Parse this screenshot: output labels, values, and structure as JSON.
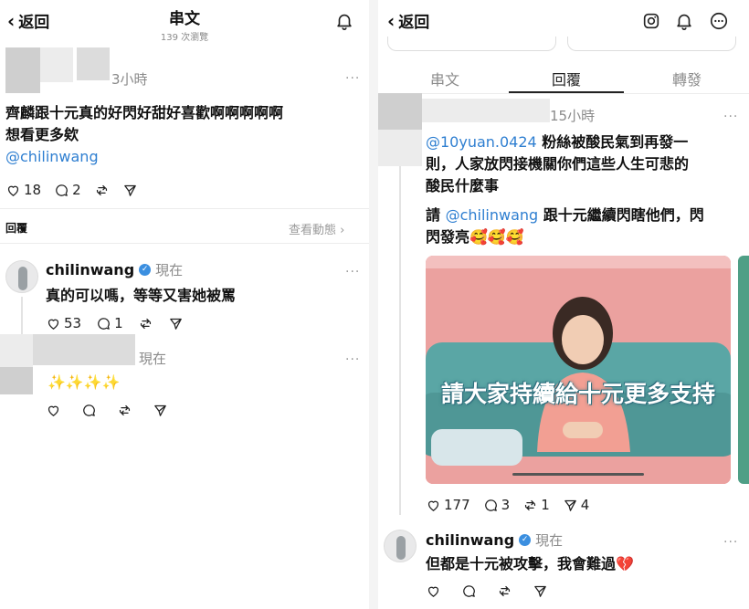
{
  "left": {
    "back_label": "返回",
    "title": "串文",
    "views": "139 次瀏覽",
    "post": {
      "time": "3小時",
      "text_line1": "齊麟跟十元真的好閃好甜好喜歡啊啊啊啊啊",
      "text_line2": "想看更多欸",
      "mention": "@chilinwang",
      "likes": "18",
      "comments": "2"
    },
    "replies_label": "回覆",
    "view_activity": "查看動態 ›",
    "reply1": {
      "username": "chilinwang",
      "time": "現在",
      "text": "真的可以嗎，等等又害她被罵",
      "likes": "53",
      "comments": "1"
    },
    "reply2": {
      "time": "現在",
      "text": "✨✨✨✨"
    }
  },
  "right": {
    "back_label": "返回",
    "tabs": [
      "串文",
      "回覆",
      "轉發"
    ],
    "post": {
      "time": "15小時",
      "mention1": "@10yuan.0424",
      "text1a": " 粉絲被酸民氣到再發一",
      "text1b": "則，人家放閃接機關你們這些人生可悲的",
      "text1c": "酸民什麼事",
      "text2a": "請 ",
      "mention2": "@chilinwang",
      "text2b": " 跟十元繼續閃瞎他們，閃",
      "text2c": "閃發亮🥰🥰🥰",
      "image_caption": "請大家持續給十元更多支持",
      "likes": "177",
      "comments": "3",
      "reposts": "1",
      "shares": "4"
    },
    "reply": {
      "username": "chilinwang",
      "time": "現在",
      "text": "但都是十元被攻擊，我會難過💔"
    }
  },
  "colors": {
    "mention": "#2f7fd1",
    "verified": "#3b8fe0",
    "photo_bg": "#e79a98",
    "sofa": "#5aa6a5"
  }
}
